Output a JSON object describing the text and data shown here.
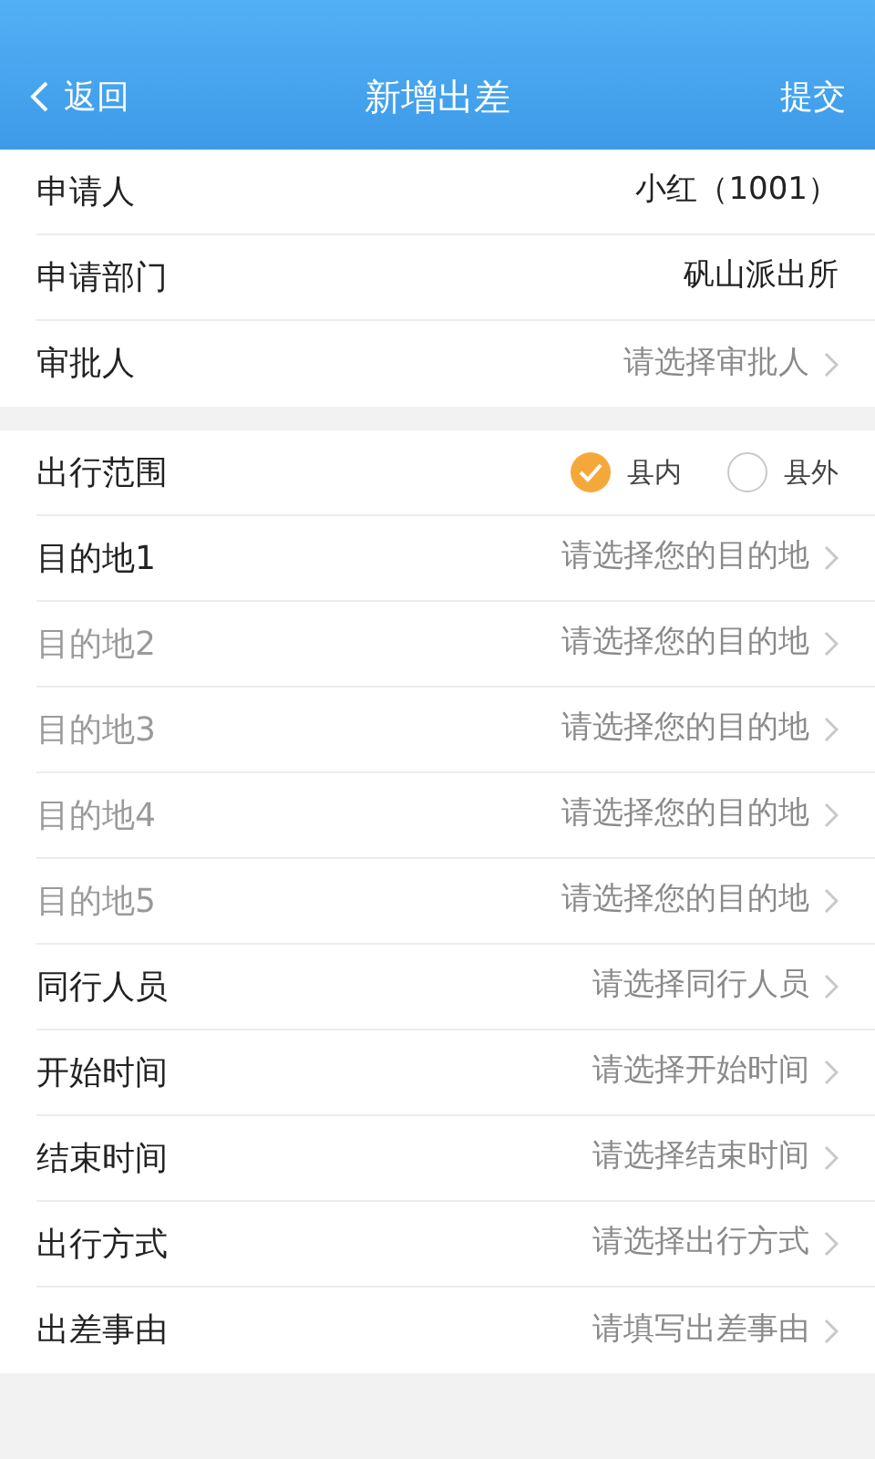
{
  "header": {
    "back": "返回",
    "title": "新增出差",
    "action": "提交"
  },
  "sections": [
    {
      "rows": [
        {
          "kind": "value",
          "label": "申请人",
          "value": "小红（1001）"
        },
        {
          "kind": "value",
          "label": "申请部门",
          "value": "矾山派出所"
        },
        {
          "kind": "picker",
          "label": "审批人",
          "placeholder": "请选择审批人",
          "disabled": false
        }
      ]
    },
    {
      "rows": [
        {
          "kind": "radio",
          "label": "出行范围",
          "options": [
            {
              "label": "县内",
              "selected": true
            },
            {
              "label": "县外",
              "selected": false
            }
          ]
        },
        {
          "kind": "picker",
          "label": "目的地1",
          "placeholder": "请选择您的目的地",
          "disabled": false
        },
        {
          "kind": "picker",
          "label": "目的地2",
          "placeholder": "请选择您的目的地",
          "disabled": true
        },
        {
          "kind": "picker",
          "label": "目的地3",
          "placeholder": "请选择您的目的地",
          "disabled": true
        },
        {
          "kind": "picker",
          "label": "目的地4",
          "placeholder": "请选择您的目的地",
          "disabled": true
        },
        {
          "kind": "picker",
          "label": "目的地5",
          "placeholder": "请选择您的目的地",
          "disabled": true
        },
        {
          "kind": "picker",
          "label": "同行人员",
          "placeholder": "请选择同行人员",
          "disabled": false
        },
        {
          "kind": "picker",
          "label": "开始时间",
          "placeholder": "请选择开始时间",
          "disabled": false
        },
        {
          "kind": "picker",
          "label": "结束时间",
          "placeholder": "请选择结束时间",
          "disabled": false
        },
        {
          "kind": "picker",
          "label": "出行方式",
          "placeholder": "请选择出行方式",
          "disabled": false
        },
        {
          "kind": "picker",
          "label": "出差事由",
          "placeholder": "请填写出差事由",
          "disabled": false
        }
      ]
    }
  ]
}
